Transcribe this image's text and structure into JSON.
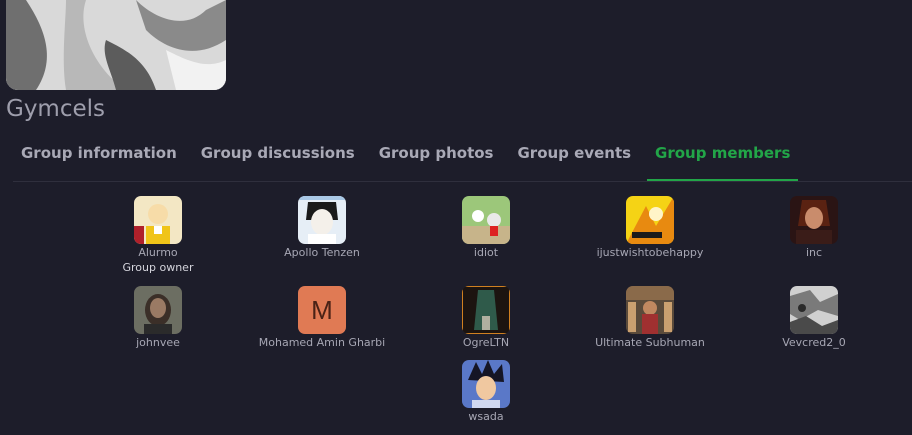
{
  "group": {
    "title": "Gymcels"
  },
  "tabs": [
    {
      "label": "Group information"
    },
    {
      "label": "Group discussions"
    },
    {
      "label": "Group photos"
    },
    {
      "label": "Group events"
    },
    {
      "label": "Group members"
    }
  ],
  "members": [
    {
      "name": "Alurmo",
      "role": "Group owner"
    },
    {
      "name": "Apollo Tenzen"
    },
    {
      "name": "idiot"
    },
    {
      "name": "ijustwishtobehappy"
    },
    {
      "name": "inc"
    },
    {
      "name": "johnvee"
    },
    {
      "name": "Mohamed Amin Gharbi",
      "initial": "M"
    },
    {
      "name": "OgreLTN"
    },
    {
      "name": "Ultimate Subhuman"
    },
    {
      "name": "Vevcred2_0"
    },
    {
      "name": "wsada"
    }
  ],
  "colors": {
    "background": "#1d1d2a",
    "accent": "#22a548",
    "tab_text": "#a9a9b6"
  }
}
